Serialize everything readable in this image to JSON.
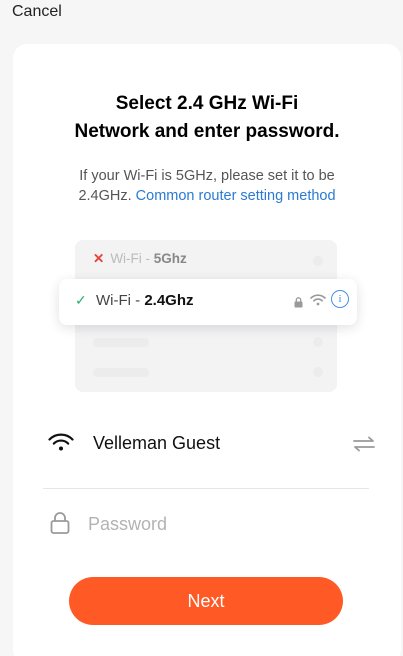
{
  "header": {
    "cancel_label": "Cancel"
  },
  "card": {
    "title_line1": "Select 2.4 GHz Wi-Fi",
    "title_line2": "Network and enter password.",
    "subtitle_line1": "If your Wi-Fi is 5GHz, please set it to be",
    "subtitle_line2_prefix": "2.4GHz.",
    "subtitle_link": "Common router setting method"
  },
  "illustration": {
    "row1_prefix": "Wi-Fi - ",
    "row1_band": "5Ghz",
    "row2_prefix": "Wi-Fi - ",
    "row2_band": "2.4Ghz",
    "info_glyph": "i"
  },
  "network": {
    "ssid": "Velleman Guest"
  },
  "password": {
    "placeholder": "Password",
    "value": ""
  },
  "actions": {
    "next_label": "Next"
  },
  "colors": {
    "accent": "#ff5a26",
    "link": "#2a7bd1",
    "check": "#27b36b",
    "error": "#e5433b"
  }
}
